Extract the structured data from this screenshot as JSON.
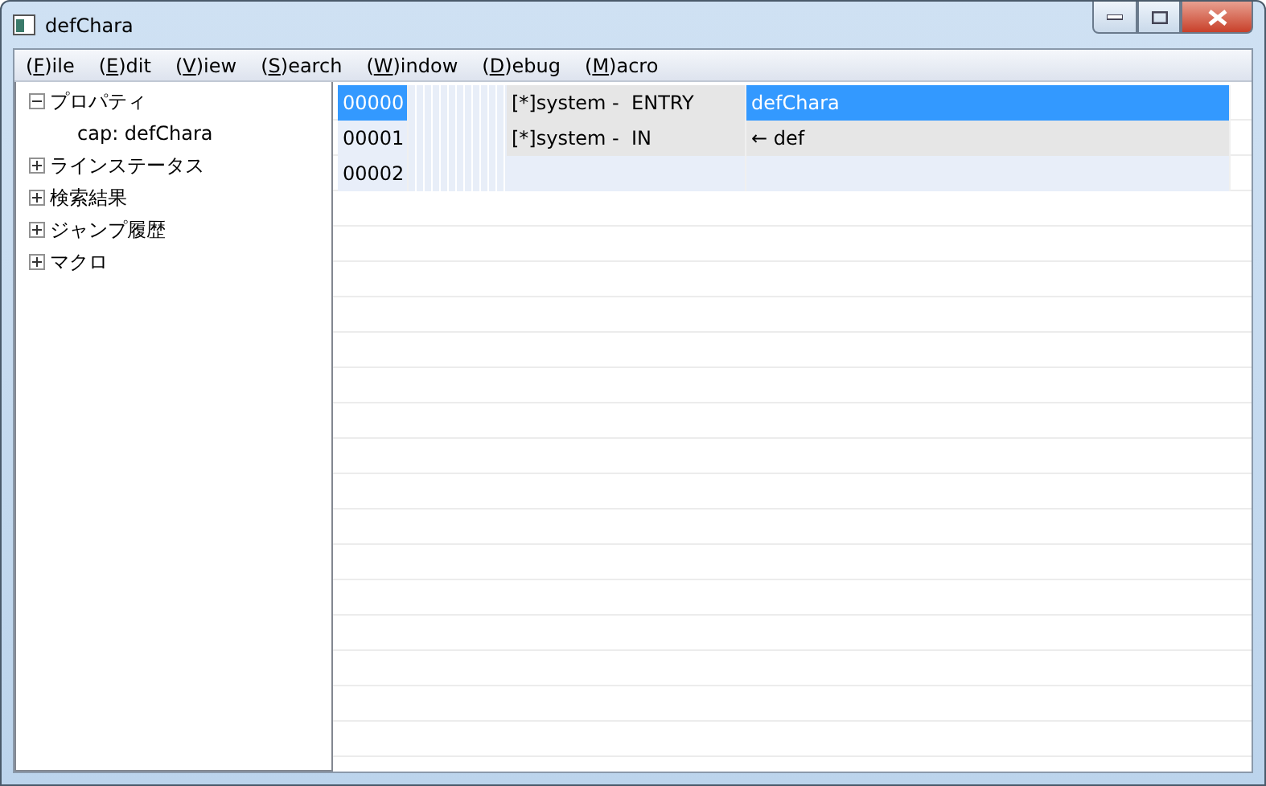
{
  "window": {
    "title": "defChara"
  },
  "menu": [
    {
      "before": "(",
      "mnemonic": "F",
      "after": ")ile"
    },
    {
      "before": "(",
      "mnemonic": "E",
      "after": ")dit"
    },
    {
      "before": "(",
      "mnemonic": "V",
      "after": ")iew"
    },
    {
      "before": "(",
      "mnemonic": "S",
      "after": ")earch"
    },
    {
      "before": "(",
      "mnemonic": "W",
      "after": ")indow"
    },
    {
      "before": "(",
      "mnemonic": "D",
      "after": ")ebug"
    },
    {
      "before": "(",
      "mnemonic": "M",
      "after": ")acro"
    }
  ],
  "tree": [
    {
      "label": "プロパティ",
      "expanded": true,
      "children": [
        {
          "label": "cap: defChara"
        }
      ]
    },
    {
      "label": "ラインステータス",
      "expanded": false
    },
    {
      "label": "検索結果",
      "expanded": false
    },
    {
      "label": "ジャンプ履歴",
      "expanded": false
    },
    {
      "label": "マクロ",
      "expanded": false
    }
  ],
  "rows": [
    {
      "number": "00000",
      "source": "[*]system -  ENTRY",
      "text": "defChara",
      "selected": true,
      "filled": true
    },
    {
      "number": "00001",
      "source": "[*]system -  IN",
      "text": "← def",
      "selected": false,
      "filled": true
    },
    {
      "number": "00002",
      "selected": false,
      "filled": false
    }
  ]
}
